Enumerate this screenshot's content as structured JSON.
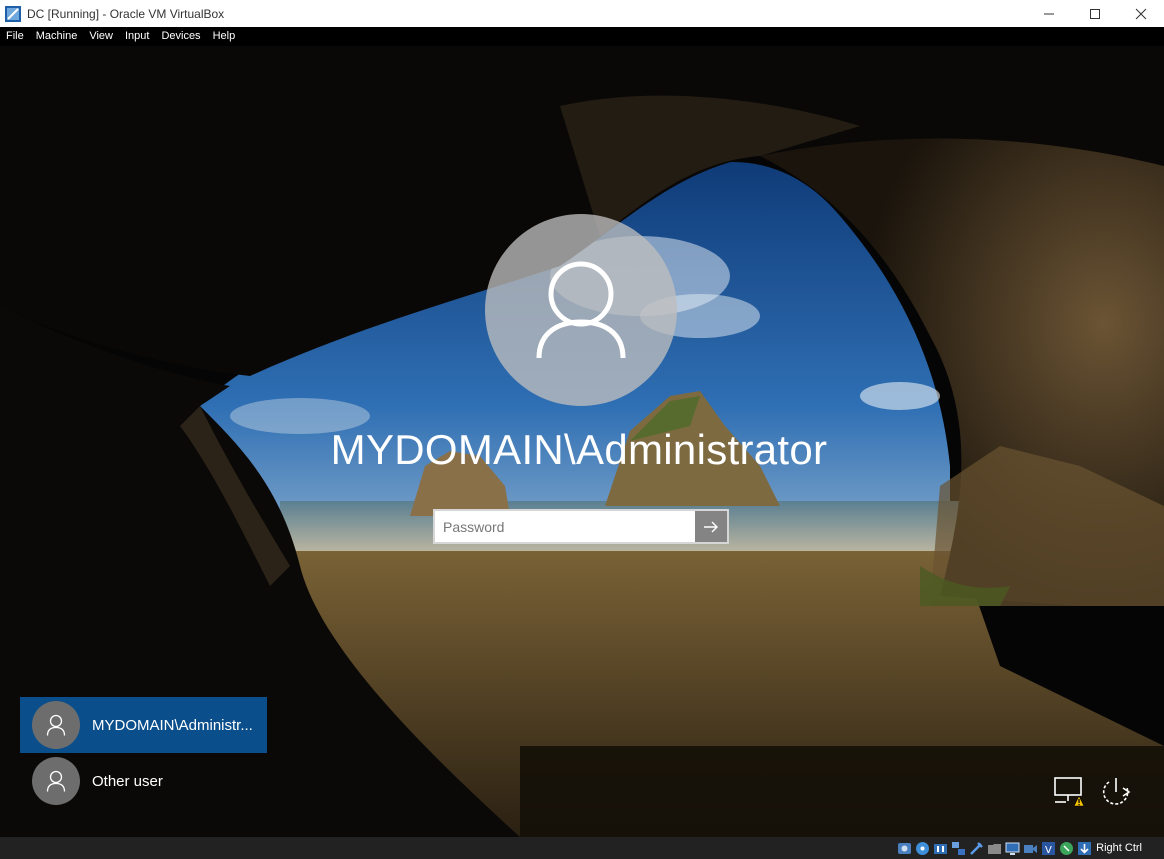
{
  "window": {
    "title": "DC [Running] - Oracle VM VirtualBox",
    "minimize_icon": "minimize-icon",
    "maximize_icon": "maximize-icon",
    "close_icon": "close-icon"
  },
  "menubar": {
    "items": [
      "File",
      "Machine",
      "View",
      "Input",
      "Devices",
      "Help"
    ]
  },
  "login": {
    "username": "MYDOMAIN\\Administrator",
    "password_placeholder": "Password",
    "password_value": "",
    "submit_icon": "arrow-right-icon"
  },
  "user_list": [
    {
      "label": "MYDOMAIN\\Administr...",
      "selected": true
    },
    {
      "label": "Other user",
      "selected": false
    }
  ],
  "corner_icons": [
    "network-warning-icon",
    "power-icon"
  ],
  "statusbar": {
    "host_key": "Right Ctrl",
    "icons": [
      "hard-disk-icon",
      "optical-drive-icon",
      "audio-icon",
      "network-icon",
      "usb-icon",
      "shared-folders-icon",
      "display-icon",
      "video-capture-icon",
      "virtualization-icon",
      "mouse-integration-icon",
      "keyboard-icon"
    ]
  },
  "colors": {
    "selected_user_bg": "#0a4f8c",
    "statusbar_bg": "#222222",
    "menubar_bg": "#000000"
  }
}
